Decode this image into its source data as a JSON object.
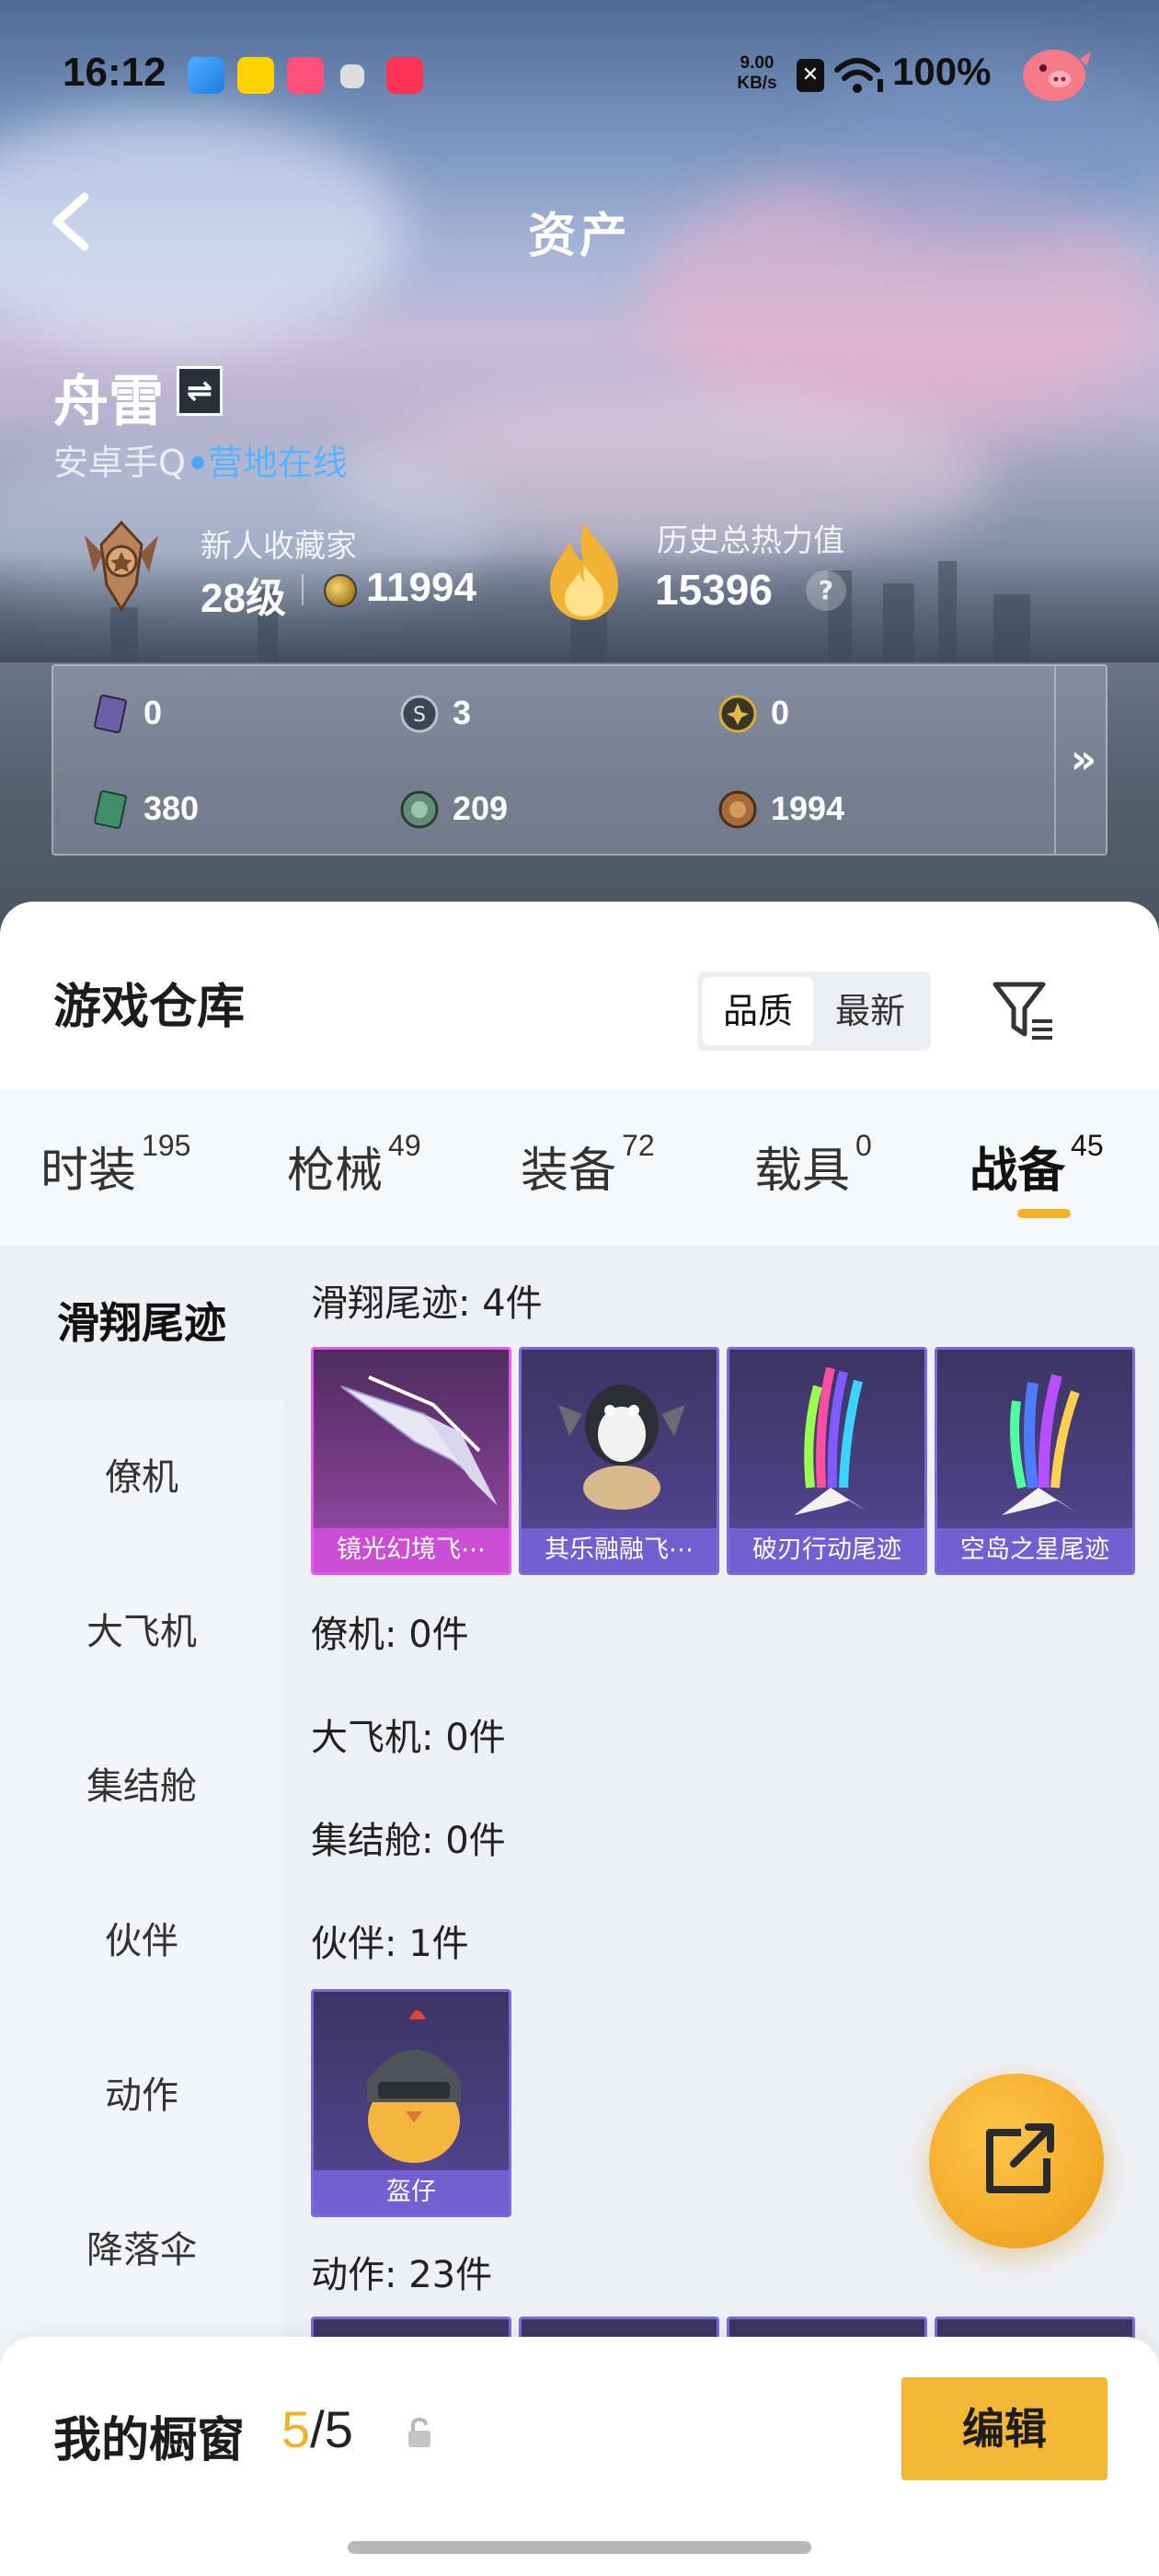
{
  "status_bar": {
    "time": "16:12",
    "net_speed_value": "9.00",
    "net_speed_unit": "KB/s",
    "battery": "100%"
  },
  "header": {
    "title": "资产"
  },
  "profile": {
    "name": "舟雷",
    "platform": "安卓手Q",
    "online_status": "营地在线",
    "rank_title": "新人收藏家",
    "level": "28级",
    "coins": "11994",
    "history_label": "历史总热力值",
    "history_value": "15396",
    "help_icon": "?"
  },
  "currencies": [
    {
      "icon": "card-purple-icon",
      "value": "0",
      "color": "#6b5fa8"
    },
    {
      "icon": "silver-token-icon",
      "value": "3",
      "color": "#6c7a8c"
    },
    {
      "icon": "gold-token-icon",
      "value": "0",
      "color": "#c49a2a"
    },
    {
      "icon": "card-green-icon",
      "value": "380",
      "color": "#3f8f6a"
    },
    {
      "icon": "green-coin-icon",
      "value": "209",
      "color": "#5f8d75"
    },
    {
      "icon": "bronze-coin-icon",
      "value": "1994",
      "color": "#a56c3b"
    }
  ],
  "warehouse": {
    "title": "游戏仓库",
    "sort_options": [
      "品质",
      "最新"
    ],
    "tabs": [
      {
        "label": "时装",
        "count": "195"
      },
      {
        "label": "枪械",
        "count": "49"
      },
      {
        "label": "装备",
        "count": "72"
      },
      {
        "label": "载具",
        "count": "0"
      },
      {
        "label": "战备",
        "count": "45",
        "active": true
      }
    ],
    "categories": [
      "滑翔尾迹",
      "僚机",
      "大飞机",
      "集结舱",
      "伙伴",
      "动作",
      "降落伞"
    ],
    "sections": [
      {
        "title": "滑翔尾迹: 4件",
        "items": [
          "镜光幻境飞⋯",
          "其乐融融飞⋯",
          "破刃行动尾迹",
          "空岛之星尾迹"
        ]
      },
      {
        "title": "僚机: 0件"
      },
      {
        "title": "大飞机: 0件"
      },
      {
        "title": "集结舱: 0件"
      },
      {
        "title": "伙伴: 1件",
        "items": [
          "盔仔"
        ]
      },
      {
        "title": "动作: 23件"
      }
    ]
  },
  "showcase": {
    "label": "我的橱窗",
    "current": "5",
    "total": "/5",
    "edit": "编辑"
  }
}
